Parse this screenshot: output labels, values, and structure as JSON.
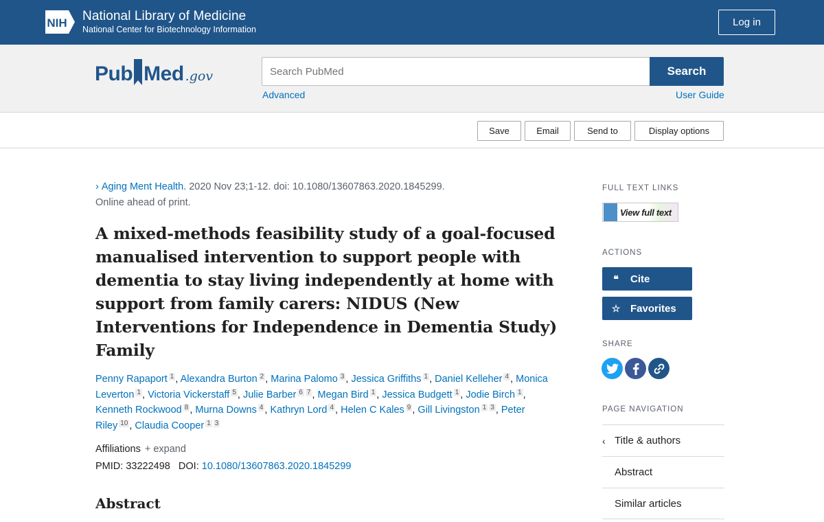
{
  "header": {
    "nih_badge": "NIH",
    "nih_title": "National Library of Medicine",
    "nih_subtitle": "National Center for Biotechnology Information",
    "login_label": "Log in"
  },
  "search": {
    "logo_pub": "Pub",
    "logo_med": "Med",
    "logo_gov": ".gov",
    "placeholder": "Search PubMed",
    "button_label": "Search",
    "advanced_label": "Advanced",
    "user_guide_label": "User Guide"
  },
  "toolbar": {
    "save_label": "Save",
    "email_label": "Email",
    "send_to_label": "Send to",
    "display_options_label": "Display options"
  },
  "article": {
    "journal": "Aging Ment Health.",
    "citation": "2020 Nov 23;1-12. doi: 10.1080/13607863.2020.1845299.",
    "status": "Online ahead of print.",
    "title": "A mixed-methods feasibility study of a goal-focused manualised intervention to support people with dementia to stay living independently at home with support from family carers: NIDUS (New Interventions for Independence in Dementia Study) Family",
    "authors": [
      {
        "name": "Penny Rapaport",
        "aff": "1"
      },
      {
        "name": "Alexandra Burton",
        "aff": "2"
      },
      {
        "name": "Marina Palomo",
        "aff": "3"
      },
      {
        "name": "Jessica Griffiths",
        "aff": "1"
      },
      {
        "name": "Daniel Kelleher",
        "aff": "4"
      },
      {
        "name": "Monica Leverton",
        "aff": "1"
      },
      {
        "name": "Victoria Vickerstaff",
        "aff": "5"
      },
      {
        "name": "Julie Barber",
        "aff": "6 7"
      },
      {
        "name": "Megan Bird",
        "aff": "1"
      },
      {
        "name": "Jessica Budgett",
        "aff": "1"
      },
      {
        "name": "Jodie Birch",
        "aff": "1"
      },
      {
        "name": "Kenneth Rockwood",
        "aff": "8"
      },
      {
        "name": "Murna Downs",
        "aff": "4"
      },
      {
        "name": "Kathryn Lord",
        "aff": "4"
      },
      {
        "name": "Helen C Kales",
        "aff": "9"
      },
      {
        "name": "Gill Livingston",
        "aff": "1 3"
      },
      {
        "name": "Peter Riley",
        "aff": "10"
      },
      {
        "name": "Claudia Cooper",
        "aff": "1 3"
      }
    ],
    "affiliations_label": "Affiliations",
    "expand_label": "+ expand",
    "pmid_label": "PMID:",
    "pmid": "33222498",
    "doi_label": "DOI:",
    "doi": "10.1080/13607863.2020.1845299",
    "abstract_heading": "Abstract"
  },
  "sidebar": {
    "full_text_heading": "FULL TEXT LINKS",
    "view_full_text_label": "View full text",
    "actions_heading": "ACTIONS",
    "cite_label": "Cite",
    "favorites_label": "Favorites",
    "share_heading": "SHARE",
    "page_nav_heading": "PAGE NAVIGATION",
    "nav_items": [
      "Title & authors",
      "Abstract",
      "Similar articles"
    ]
  },
  "colors": {
    "nih_blue": "#20558a",
    "link_blue": "#0071bc",
    "twitter": "#1da1f2",
    "facebook": "#3b5998",
    "permalink": "#20558a"
  }
}
